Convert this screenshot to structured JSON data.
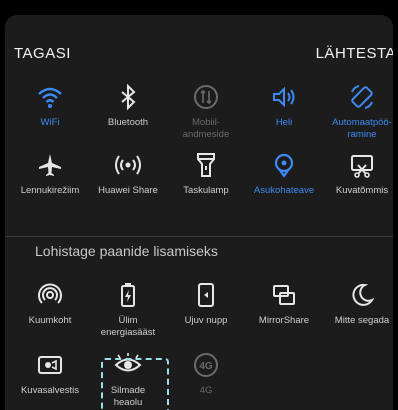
{
  "header": {
    "back_label": "TAGASI",
    "reset_label": "LÄHTESTA"
  },
  "active_tiles": [
    {
      "id": "wifi",
      "label": "WiFi",
      "state": "on",
      "icon": "wifi-icon"
    },
    {
      "id": "bluetooth",
      "label": "Bluetooth",
      "state": "off",
      "icon": "bluetooth-icon"
    },
    {
      "id": "mobile-data",
      "label": "Mobiil-\nandmeside",
      "state": "disabled",
      "icon": "mobile-data-icon"
    },
    {
      "id": "sound",
      "label": "Heli",
      "state": "on",
      "icon": "speaker-icon"
    },
    {
      "id": "auto-rotate",
      "label": "Automaatpöö-\nramine",
      "state": "on",
      "icon": "rotate-icon"
    },
    {
      "id": "airplane",
      "label": "Lennukirežiim",
      "state": "off",
      "icon": "airplane-icon"
    },
    {
      "id": "huawei-share",
      "label": "Huawei Share",
      "state": "off",
      "icon": "huawei-share-icon"
    },
    {
      "id": "flashlight",
      "label": "Taskulamp",
      "state": "off",
      "icon": "flashlight-icon"
    },
    {
      "id": "location",
      "label": "Asukohateave",
      "state": "on",
      "icon": "location-icon"
    },
    {
      "id": "screenshot",
      "label": "Kuvatõmmis",
      "state": "off",
      "icon": "screenshot-icon"
    }
  ],
  "hint": "Lohistage paanide lisamiseks",
  "extra_tiles": [
    {
      "id": "hotspot",
      "label": "Kuumkoht",
      "state": "off",
      "icon": "hotspot-icon"
    },
    {
      "id": "ultra-power",
      "label": "Ülim\nenergiasääst",
      "state": "off",
      "icon": "battery-saver-icon"
    },
    {
      "id": "floating-dock",
      "label": "Ujuv nupp",
      "state": "off",
      "icon": "floating-button-icon"
    },
    {
      "id": "mirrorshare",
      "label": "MirrorShare",
      "state": "off",
      "icon": "mirrorshare-icon"
    },
    {
      "id": "dnd",
      "label": "Mitte segada",
      "state": "off",
      "icon": "moon-icon"
    },
    {
      "id": "screen-record",
      "label": "Kuvasalvestis",
      "state": "off",
      "icon": "screen-record-icon"
    },
    {
      "id": "eye-comfort",
      "label": "Silmade\nheaolu",
      "state": "off",
      "icon": "eye-icon"
    },
    {
      "id": "4g",
      "label": "4G",
      "state": "disabled",
      "icon": "4g-icon"
    }
  ],
  "colors": {
    "accent": "#3d8af2",
    "icon": "#e6e6e6",
    "dim": "#6b6b6b",
    "panel": "#1c1c1c",
    "highlight": "#9adfe8"
  }
}
